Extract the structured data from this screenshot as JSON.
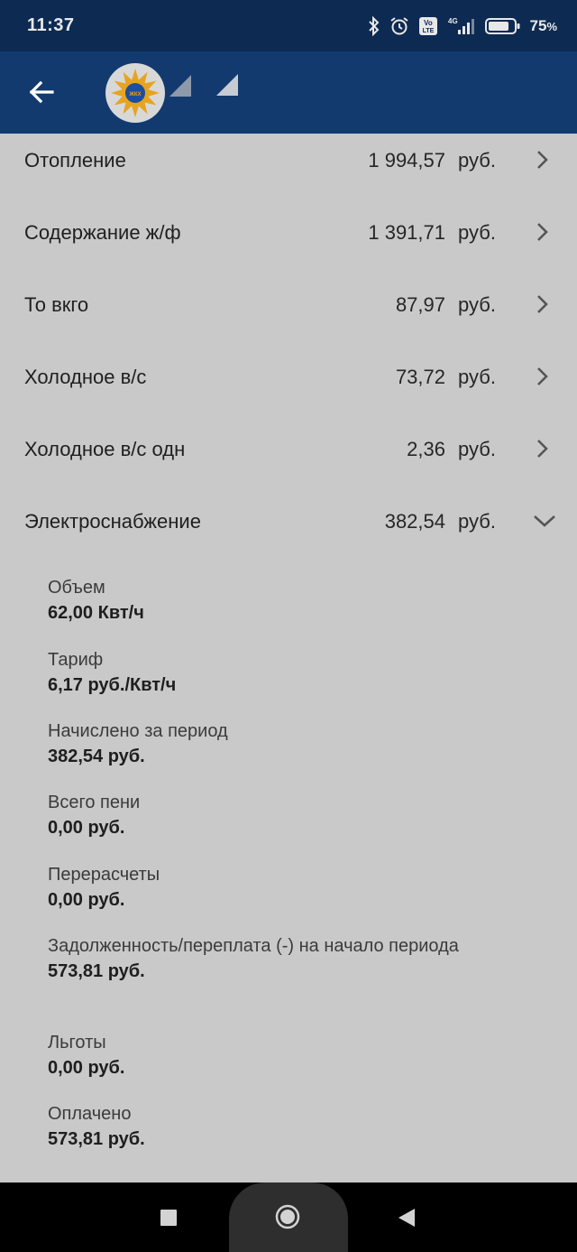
{
  "status_bar": {
    "time": "11:37",
    "network": "4G",
    "volte": "Vo LTE",
    "battery_percent": "75",
    "battery_unit": "%"
  },
  "app_bar": {
    "back_icon": "arrow-left-icon",
    "logo_text": "ЖКХ"
  },
  "charges": [
    {
      "label": "Отопление",
      "amount": "1 994,57",
      "unit": "руб.",
      "chevron": "chevron-right-icon"
    },
    {
      "label": "Содержание ж/ф",
      "amount": "1 391,71",
      "unit": "руб.",
      "chevron": "chevron-right-icon"
    },
    {
      "label": "То вкго",
      "amount": "87,97",
      "unit": "руб.",
      "chevron": "chevron-right-icon"
    },
    {
      "label": "Холодное в/с",
      "amount": "73,72",
      "unit": "руб.",
      "chevron": "chevron-right-icon"
    },
    {
      "label": "Холодное в/с одн",
      "amount": "2,36",
      "unit": "руб.",
      "chevron": "chevron-right-icon"
    },
    {
      "label": "Электроснабжение",
      "amount": "382,54",
      "unit": "руб.",
      "chevron": "chevron-down-icon"
    }
  ],
  "electricity_details": [
    {
      "label": "Объем",
      "value": "62,00 Квт/ч"
    },
    {
      "label": "Тариф",
      "value": "6,17 руб./Квт/ч"
    },
    {
      "label": "Начислено за период",
      "value": "382,54 руб."
    },
    {
      "label": "Всего пени",
      "value": "0,00 руб."
    },
    {
      "label": "Перерасчеты",
      "value": "0,00 руб."
    },
    {
      "label": "Задолженность/переплата (-) на начало периода",
      "value": "573,81 руб."
    },
    {
      "label": "Льготы",
      "value": "0,00 руб."
    },
    {
      "label": "Оплачено",
      "value": "573,81 руб."
    }
  ],
  "colors": {
    "status_bar": "#0d2a52",
    "app_bar": "#123a6f",
    "background": "#c9c9c9"
  }
}
